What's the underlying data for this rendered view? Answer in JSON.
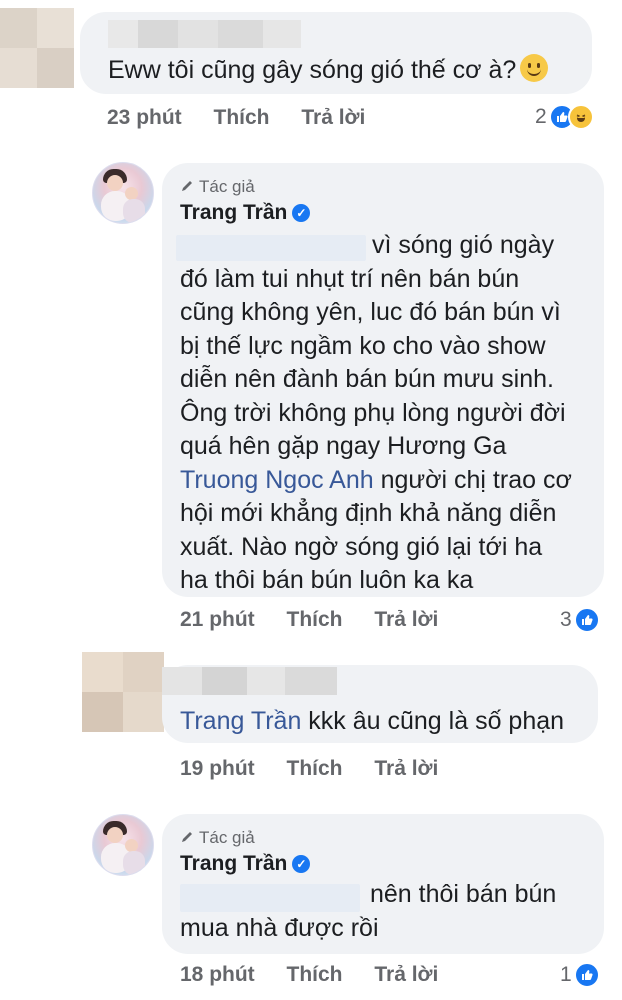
{
  "comments": [
    {
      "text": "Eww tôi cũng gây sóng gió thế cơ à?",
      "time": "23 phút",
      "like": "Thích",
      "reply": "Trả lời",
      "reaction_count": "2",
      "reactions": [
        "like-icon",
        "haha-icon"
      ]
    },
    {
      "badge": "Tác giả",
      "author": "Trang Trần",
      "lines": [
        "vì sóng gió ngày",
        "đó làm tui nhụt trí nên bán bún",
        "cũng không yên, luc đó bán bún vì",
        "bị thế lực ngầm ko cho vào show",
        "diễn nên đành bán bún mưu sinh.",
        "Ông trời không phụ lòng người đời",
        "quá hên gặp ngay Hương Ga"
      ],
      "mention_name": "Truong Ngoc Anh",
      "line8_rest": " người chị trao cơ",
      "lines_end": [
        "hội mới khẳng định khả năng diễn",
        "xuất. Nào ngờ sóng gió lại tới ha",
        "ha thôi bán bún luôn ka ka"
      ],
      "time": "21 phút",
      "like": "Thích",
      "reply": "Trả lời",
      "reaction_count": "3"
    },
    {
      "mention_name": "Trang Trần",
      "text_rest": " kkk âu cũng là số phạn",
      "time": "19 phút",
      "like": "Thích",
      "reply": "Trả lời"
    },
    {
      "badge": "Tác giả",
      "author": "Trang Trần",
      "line1": "nên thôi bán bún",
      "line2": "mua nhà được rồi",
      "time": "18 phút",
      "like": "Thích",
      "reply": "Trả lời",
      "reaction_count": "1"
    }
  ],
  "colors": {
    "bubble": "#f0f2f5",
    "link": "#385898",
    "meta": "#65676b",
    "like_blue": "#1877f2"
  }
}
